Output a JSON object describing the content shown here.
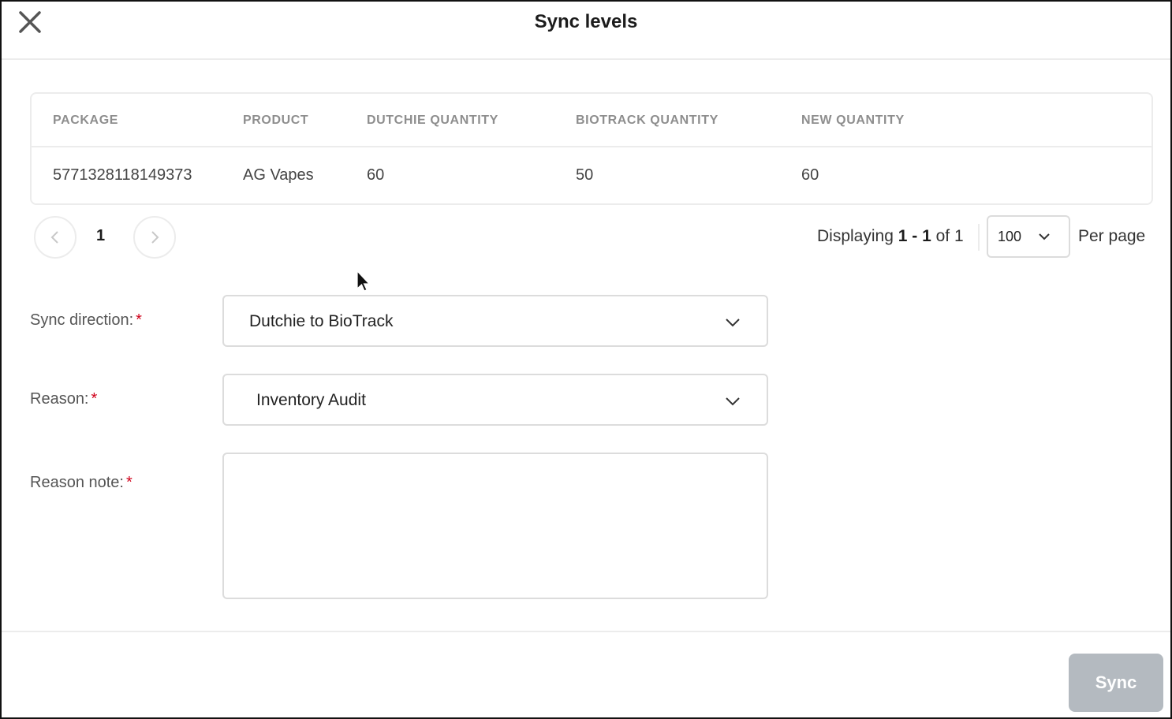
{
  "modal": {
    "title": "Sync levels",
    "close_icon": "close-icon"
  },
  "table": {
    "columns": [
      "PACKAGE",
      "PRODUCT",
      "DUTCHIE QUANTITY",
      "BIOTRACK QUANTITY",
      "NEW QUANTITY"
    ],
    "rows": [
      [
        "5771328118149373",
        "AG Vapes",
        "60",
        "50",
        "60"
      ]
    ]
  },
  "pagination": {
    "current_page": "1",
    "displaying_prefix": "Displaying",
    "displaying_range": "1 - 1",
    "displaying_suffix": "of 1",
    "per_page_value": "100",
    "per_page_label": "Per page"
  },
  "form": {
    "sync_direction": {
      "label": "Sync direction:",
      "required_mark": "*",
      "value": "Dutchie to BioTrack"
    },
    "reason": {
      "label": "Reason:",
      "required_mark": "*",
      "value": "Inventory Audit"
    },
    "reason_note": {
      "label": "Reason note:",
      "required_mark": "*",
      "value": ""
    }
  },
  "footer": {
    "sync_label": "Sync",
    "sync_disabled_color": "#b4bac0"
  },
  "colors": {
    "required": "#d0021b",
    "border": "#ececec",
    "header_text": "#8e8e8e"
  }
}
